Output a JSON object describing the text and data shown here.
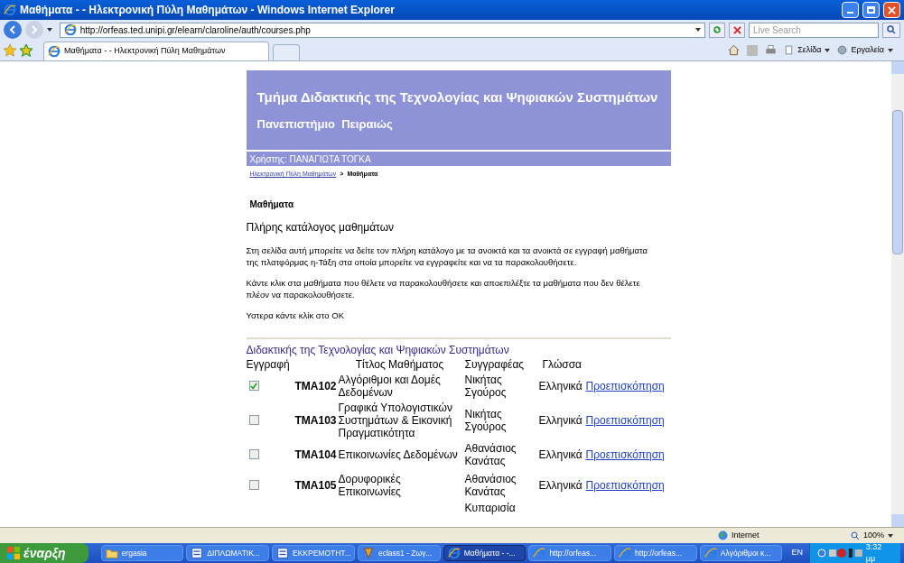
{
  "window": {
    "title": "Μαθήματα - - Ηλεκτρονική Πύλη Μαθημάτων - Windows Internet Explorer"
  },
  "address_bar": {
    "url": "http://orfeas.ted.unipi.gr/elearn/claroline/auth/courses.php",
    "search_placeholder": "Live Search"
  },
  "tabs": [
    {
      "label": "Μαθήματα - - Ηλεκτρονική Πύλη Μαθημάτων",
      "selected": true
    }
  ],
  "command_bar": [
    "Σελίδα",
    "Εργαλεία"
  ],
  "banner": {
    "title": "Τμήμα Διδακτικής της Τεχνολογίας και Ψηφιακών Συστημάτων",
    "subtitle": "Πανεπιστήμιο  Πειραιώς",
    "user": "Χρήστης: ΠΑΝΑΓΙΩΤΑ ΤΟΓΚΑ"
  },
  "breadcrumb": {
    "link": "Ηλεκτρονική Πύλη Μαθημάτων",
    "separator": ">",
    "current": "Μαθήματα"
  },
  "heading": "Μαθήματα",
  "subheading": "Πλήρης κατάλογος μαθημάτων",
  "paragraphs": [
    "Στη σελίδα αυτή μπορείτε να δείτε τον πλήρη κατάλογο με τα ανοικτά και τα ανοικτά σε εγγραφή μαθήματα της πλατφόρμας η-Τάξη στα οποία μπορείτε να εγγραφείτε και να τα παρακολουθήσετε.",
    "Κάντε κλικ στα μαθήματα που θέλετε να παρακολουθήσετε και αποεπιλέξτε τα μαθήματα που δεν θέλετε πλέον να παρακολουθήσετε.",
    "Υστερα κάντε κλίκ στο ΟΚ"
  ],
  "category": "Διδακτικής της Τεχνολογίας και Ψηφιακών Συστημάτων",
  "columns": [
    "Εγγραφή",
    "Τίτλος Μαθήματος",
    "Συγγραφέας",
    "Γλώσσα"
  ],
  "rows": [
    {
      "checked": true,
      "code": "TMA102",
      "title": "Αλγόριθμοι και Δομές Δεδομένων",
      "author": "Νικήτας Σγούρος",
      "language": "Ελληνικά",
      "link": "Προεπισκόπηση"
    },
    {
      "checked": false,
      "code": "TMA103",
      "title": "Γραφικά Υπολογιστικών Συστημάτων & Εικονική Πραγματικότητα",
      "author": "Νικήτας Σγούρος",
      "language": "Ελληνικά",
      "link": "Προεπισκόπηση"
    },
    {
      "checked": false,
      "code": "TMA104",
      "title": "Επικοινωνίες Δεδομένων",
      "author": "Αθανάσιος Κανάτας",
      "language": "Ελληνικά",
      "link": "Προεπισκόπηση"
    },
    {
      "checked": false,
      "code": "TMA105",
      "title": "Δορυφορικές Επικοινωνίες",
      "author": "Αθανάσιος Κανάτας",
      "language": "Ελληνικά",
      "link": "Προεπισκόπηση"
    },
    {
      "author": "Κυπαρισία"
    }
  ],
  "status_bar": {
    "zone": "Internet",
    "zoom": "100%"
  },
  "taskbar": {
    "start": "έναρξη",
    "tasks": [
      {
        "kind": "folder",
        "label": "ergasia",
        "selected": false
      },
      {
        "kind": "doc",
        "label": "ΔΙΠΛΩΜΑΤΙΚ...",
        "selected": false
      },
      {
        "kind": "doc",
        "label": "ΕΚΚΡΕΜΟΤΗΤ...",
        "selected": false
      },
      {
        "kind": "app",
        "label": "eclass1 - Ζωγ...",
        "selected": false
      },
      {
        "kind": "ie",
        "label": "Μαθήματα - -...",
        "selected": true
      },
      {
        "kind": "ie",
        "label": "http://orfeas...",
        "selected": false
      },
      {
        "kind": "ie",
        "label": "http://orfeas...",
        "selected": false
      },
      {
        "kind": "ie",
        "label": "Αλγόριθμοι κ...",
        "selected": false
      }
    ],
    "language": "EN",
    "clock": "3:32 μμ"
  }
}
